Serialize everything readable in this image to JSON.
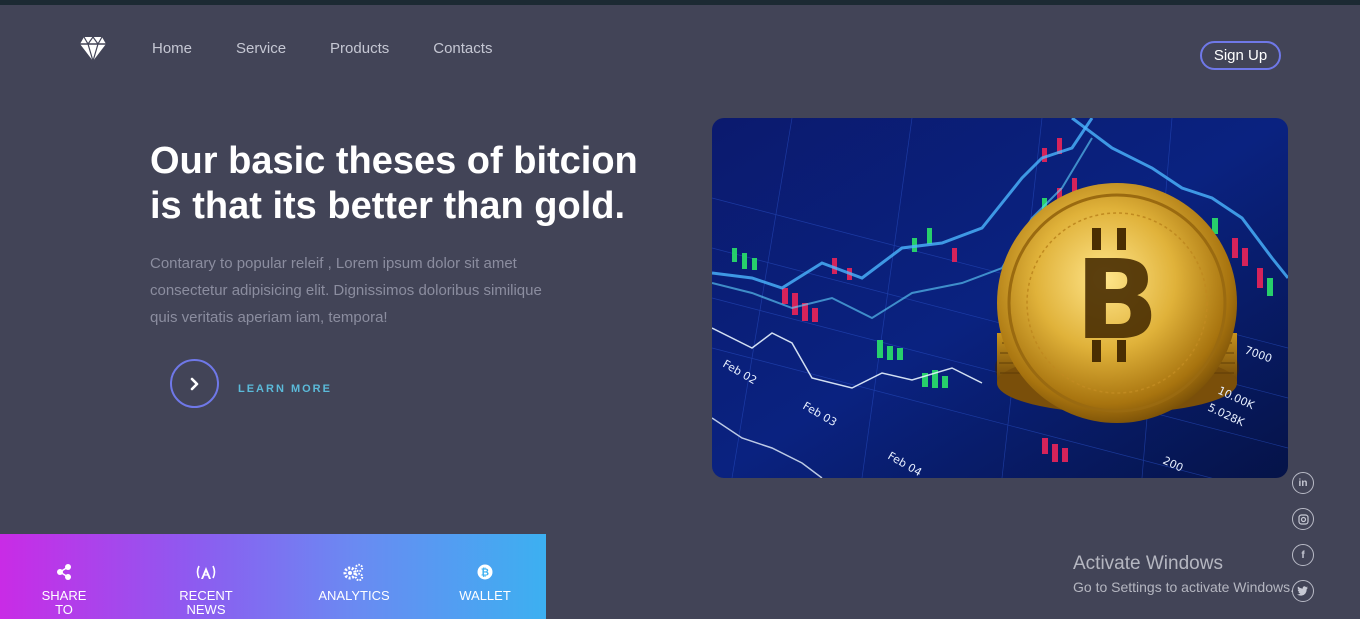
{
  "nav": {
    "items": [
      {
        "label": "Home"
      },
      {
        "label": "Service"
      },
      {
        "label": "Products"
      },
      {
        "label": "Contacts"
      }
    ],
    "signup_label": "Sign Up"
  },
  "hero": {
    "headline_line1": "Our basic theses of bitcion",
    "headline_line2": "is that its better than gold.",
    "paragraph_line1": "Contarary to popular releif , Lorem ipsum dolor sit amet",
    "paragraph_line2": "consectetur adipisicing elit. Dignissimos doloribus similique",
    "paragraph_line3": "quis veritatis aperiam iam, tempora!",
    "learn_more": "LEARN MORE",
    "image_labels": {
      "feb02": "Feb 02",
      "feb03": "Feb 03",
      "feb04": "Feb 04",
      "v7000": "7000",
      "v10k": "10.00K",
      "v5k": "5.028K",
      "v200": "200"
    }
  },
  "bottom_bar": {
    "items": [
      {
        "line1": "SHARE",
        "line2": "TO",
        "icon": "share-icon"
      },
      {
        "line1": "RECENT",
        "line2": "NEWS",
        "icon": "broadcast-icon"
      },
      {
        "line1": "ANALYTICS",
        "line2": "",
        "icon": "gears-icon"
      },
      {
        "line1": "WALLET",
        "line2": "",
        "icon": "bitcoin-icon"
      }
    ]
  },
  "social": [
    {
      "name": "linkedin",
      "glyph": "in"
    },
    {
      "name": "instagram",
      "glyph": ""
    },
    {
      "name": "facebook",
      "glyph": "f"
    },
    {
      "name": "twitter",
      "glyph": ""
    }
  ],
  "watermark": {
    "title": "Activate Windows",
    "subtitle": "Go to Settings to activate Windows."
  },
  "colors": {
    "background": "#424457",
    "accent_border": "#6f78e8",
    "learn_more": "#5bbad9",
    "gradient_start": "#c92be6",
    "gradient_end": "#3cb0f1"
  }
}
